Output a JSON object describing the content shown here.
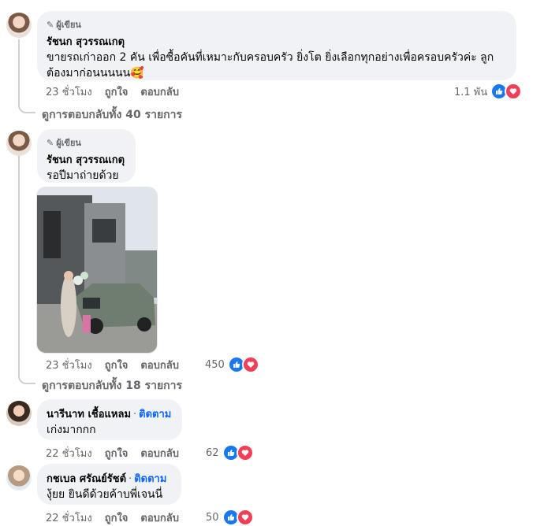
{
  "comments": [
    {
      "badge": "ผู้เขียน",
      "name": "รัชนก สุวรรณเกตุ",
      "text_line1": "ขายรถเก่าออก 2 คัน เพื่อซื้อคันที่เหมาะกับครอบครัว ยิ่งโต ยิ่งเลือกทุกอย่างเพื่อครอบครัวค่ะ ลูก",
      "text_line2": "ต้องมาก่อนนนนน🥰",
      "time": "23 ชั่วโมง",
      "like": "ถูกใจ",
      "reply": "ตอบกลับ",
      "reactions": "1.1 พัน"
    },
    {
      "badge": "ผู้เขียน",
      "name": "รัชนก สุวรรณเกตุ",
      "text": "รอปีมาถ่ายด้วย",
      "time": "23 ชั่วโมง",
      "like": "ถูกใจ",
      "reply": "ตอบกลับ",
      "reactions": "450"
    },
    {
      "name": "นารีนาท เชื้อแหลม",
      "follow": "ติดตาม",
      "text": "เก่งมากกก",
      "time": "22 ชั่วโมง",
      "like": "ถูกใจ",
      "reply": "ตอบกลับ",
      "reactions": "62"
    },
    {
      "name": "กชเบล ศรัณย์รัชต์",
      "follow": "ติดตาม",
      "text": "งุ้ยย ยินดีด้วยค้าบพี่เจนนี่",
      "time": "22 ชั่วโมง",
      "like": "ถูกใจ",
      "reply": "ตอบกลับ",
      "reactions": "50"
    }
  ],
  "view_replies": [
    "ดูการตอบกลับทั้ง 40 รายการ",
    "ดูการตอบกลับทั้ง 18 รายการ"
  ],
  "colors": {
    "like": "#1877f2",
    "love": "#f33e58",
    "link": "#0866ff",
    "bubble": "#f0f2f5",
    "meta": "#65676b"
  }
}
